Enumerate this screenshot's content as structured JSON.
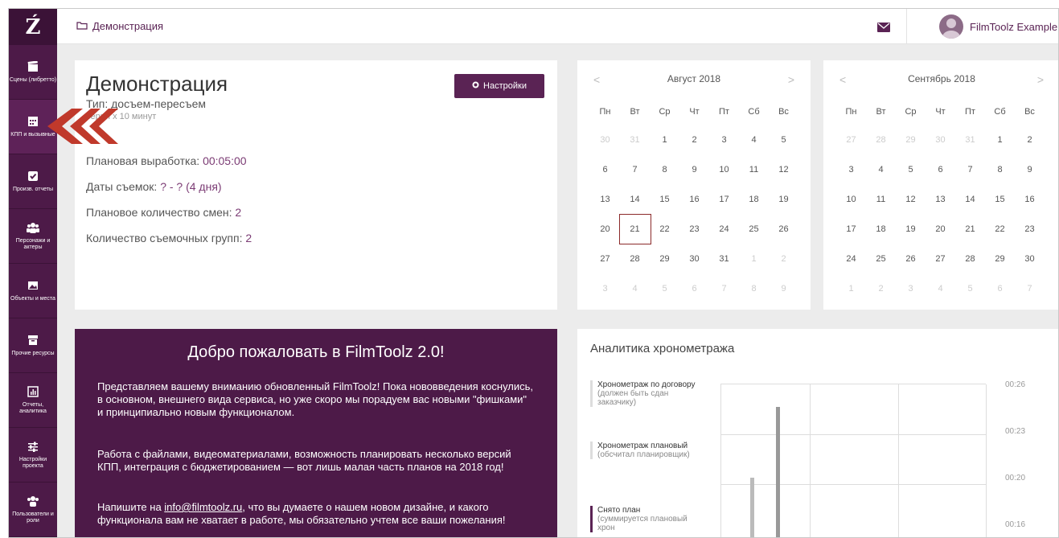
{
  "sidebar": {
    "logo": "Ź",
    "items": [
      {
        "label": "Сцены (либретто)",
        "icon": "clapperboard-icon"
      },
      {
        "label": "КПП и вызывные",
        "icon": "calendar-grid-icon"
      },
      {
        "label": "Произв. отчеты",
        "icon": "checkbox-icon"
      },
      {
        "label": "Персонажи и актеры",
        "icon": "people-icon"
      },
      {
        "label": "Объекты и места",
        "icon": "picture-icon"
      },
      {
        "label": "Прочие ресурсы",
        "icon": "archive-icon"
      },
      {
        "label": "Отчеты, аналитика",
        "icon": "bar-chart-icon"
      },
      {
        "label": "Настройки проекта",
        "icon": "sliders-icon"
      },
      {
        "label": "Пользователи и роли",
        "icon": "users-icon"
      }
    ]
  },
  "topbar": {
    "breadcrumb": "Демонстрация",
    "username": "FilmToolz Example"
  },
  "project": {
    "title": "Демонстрация",
    "type_line": "Тип: досъем-пересъем",
    "episodes_line": "серии х 10 минут",
    "settings_label": "Настройки",
    "stats": [
      {
        "label": "Плановая выработка: ",
        "value": "00:05:00"
      },
      {
        "label": "Даты съемок: ",
        "value": "? - ? (4 дня)"
      },
      {
        "label": "Плановое количество смен: ",
        "value": "2"
      },
      {
        "label": "Количество съемочных групп: ",
        "value": "2"
      }
    ]
  },
  "calendars": [
    {
      "month": "Август 2018",
      "prev": "<",
      "next": ">",
      "weekdays": [
        "Пн",
        "Вт",
        "Ср",
        "Чт",
        "Пт",
        "Сб",
        "Вс"
      ],
      "weeks": [
        [
          "30",
          "31",
          "1",
          "2",
          "3",
          "4",
          "5"
        ],
        [
          "6",
          "7",
          "8",
          "9",
          "10",
          "11",
          "12"
        ],
        [
          "13",
          "14",
          "15",
          "16",
          "17",
          "18",
          "19"
        ],
        [
          "20",
          "21",
          "22",
          "23",
          "24",
          "25",
          "26"
        ],
        [
          "27",
          "28",
          "29",
          "30",
          "31",
          "1",
          "2"
        ],
        [
          "3",
          "4",
          "5",
          "6",
          "7",
          "8",
          "9"
        ]
      ],
      "today": "21"
    },
    {
      "month": "Сентябрь 2018",
      "prev": "<",
      "next": ">",
      "weekdays": [
        "Пн",
        "Вт",
        "Ср",
        "Чт",
        "Пт",
        "Сб",
        "Вс"
      ],
      "weeks": [
        [
          "27",
          "28",
          "29",
          "30",
          "31",
          "1",
          "2"
        ],
        [
          "3",
          "4",
          "5",
          "6",
          "7",
          "8",
          "9"
        ],
        [
          "10",
          "11",
          "12",
          "13",
          "14",
          "15",
          "16"
        ],
        [
          "17",
          "18",
          "19",
          "20",
          "21",
          "22",
          "23"
        ],
        [
          "24",
          "25",
          "26",
          "27",
          "28",
          "29",
          "30"
        ],
        [
          "1",
          "2",
          "3",
          "4",
          "5",
          "6",
          "7"
        ]
      ]
    }
  ],
  "welcome": {
    "title": "Добро пожаловать в FilmToolz 2.0!",
    "p1": "Представляем вашему вниманию обновленный FilmToolz! Пока нововведения коснулись, в основном, внешнего вида сервиса, но уже скоро мы порадуем вас новыми \"фишками\" и принципиально новым функционалом.",
    "p2": "Работа с файлами, видеоматериалами, возможность планировать несколько версий КПП, интеграция с бюджетированием — вот лишь малая часть планов на 2018 год!",
    "p3_before": "Напишите на ",
    "p3_email": "info@filmtoolz.ru",
    "p3_after": ", что вы думаете о нашем новом дизайне, и какого функционала вам не хватает в работе, мы обязательно учтем все ваши пожелания!"
  },
  "analytics": {
    "title": "Аналитика хронометража",
    "legend": [
      {
        "title": "Хронометраж по договору",
        "desc": "(должен быть сдан заказчику)"
      },
      {
        "title": "Хронометраж плановый",
        "desc": "(обсчитал планировщик)"
      },
      {
        "title": "Снято план",
        "desc": "(суммируется плановый хрон"
      }
    ],
    "y_ticks": [
      "00:26",
      "00:23",
      "00:20",
      "00:16"
    ]
  },
  "colors": {
    "accent": "#5a2354",
    "sidebar": "#4d1a48",
    "arrow": "#c0392b"
  }
}
